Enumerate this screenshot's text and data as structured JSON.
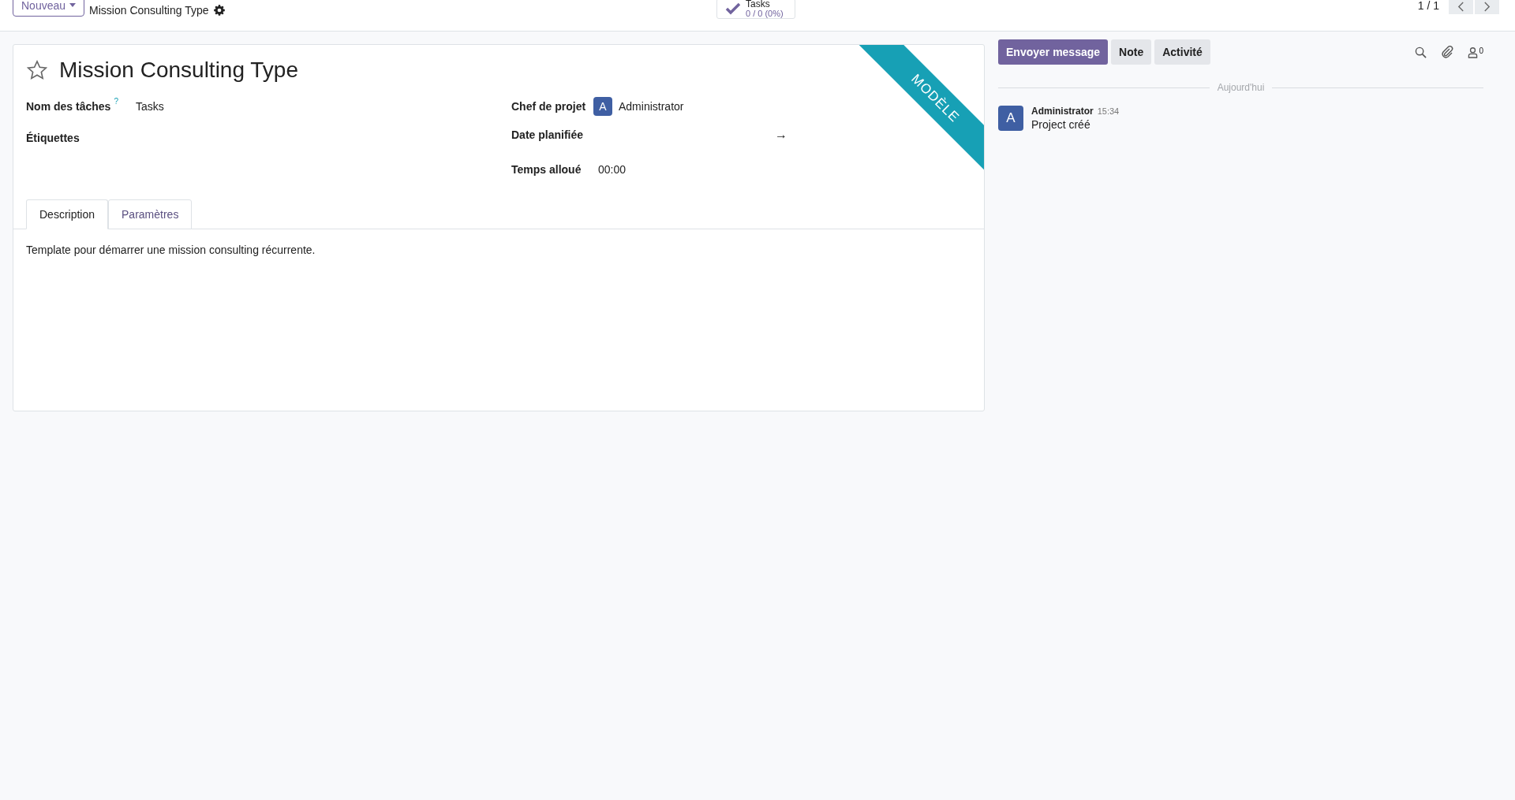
{
  "control_panel": {
    "new_button": "Nouveau",
    "breadcrumb_current": "Mission Consulting Type",
    "smart_button": {
      "label": "Tasks",
      "value": "0 / 0 (0%)"
    },
    "pager": {
      "value": "1 / 1"
    }
  },
  "form": {
    "favorite": false,
    "title": "Mission Consulting Type",
    "ribbon": "MODÈLE",
    "left_fields": [
      {
        "label": "Nom des tâches",
        "help": "?",
        "kind": "text",
        "value": "Tasks"
      },
      {
        "label": "Étiquettes",
        "kind": "empty"
      }
    ],
    "right_fields": [
      {
        "label": "Chef de projet",
        "kind": "user",
        "avatar": "A",
        "value": "Administrator"
      },
      {
        "label": "Date planifiée",
        "kind": "daterange",
        "separator": "→"
      },
      {
        "label": "Temps alloué",
        "kind": "text",
        "value": "00:00"
      }
    ],
    "tabs": [
      {
        "label": "Description",
        "selected": true
      },
      {
        "label": "Paramètres",
        "selected": false
      }
    ],
    "description": "Template pour démarrer une mission consulting récurrente."
  },
  "chatter": {
    "buttons": [
      {
        "label": "Envoyer message",
        "primary": true
      },
      {
        "label": "Note",
        "primary": false
      },
      {
        "label": "Activité",
        "primary": false
      }
    ],
    "followers_count": "0",
    "date_separator": "Aujourd'hui",
    "messages": [
      {
        "avatar": "A",
        "author": "Administrator",
        "time": "15:34",
        "body": "Project créé"
      }
    ]
  }
}
